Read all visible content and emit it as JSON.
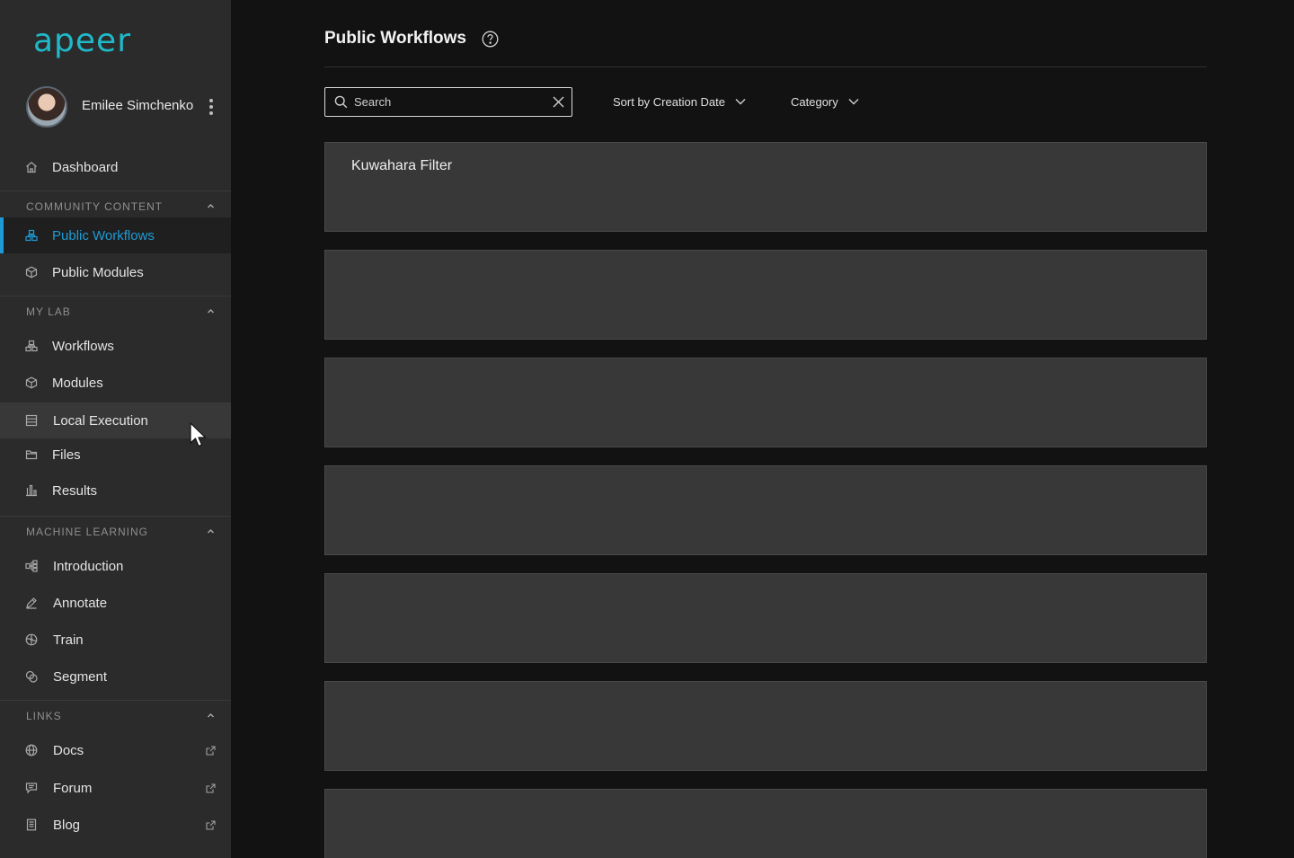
{
  "brand": {
    "logo": "apeer",
    "accent": "#1fb9c9",
    "active_color": "#1e9bd7"
  },
  "user": {
    "name": "Emilee Simchenko"
  },
  "sidebar": {
    "dashboard": "Dashboard",
    "sections": [
      {
        "label": "COMMUNITY CONTENT",
        "items": [
          "Public Workflows",
          "Public Modules"
        ]
      },
      {
        "label": "MY LAB",
        "items": [
          "Workflows",
          "Modules",
          "Local Execution",
          "Files",
          "Results"
        ]
      },
      {
        "label": "MACHINE LEARNING",
        "items": [
          "Introduction",
          "Annotate",
          "Train",
          "Segment"
        ]
      },
      {
        "label": "LINKS",
        "items": [
          "Docs",
          "Forum",
          "Blog"
        ]
      }
    ],
    "active_item": "Public Workflows",
    "hovered_item": "Local Execution"
  },
  "main": {
    "title": "Public Workflows",
    "search": {
      "placeholder": "Search",
      "value": ""
    },
    "sort_label": "Sort by Creation Date",
    "category_label": "Category",
    "cards": [
      {
        "title": "Kuwahara Filter"
      },
      {
        "title": ""
      },
      {
        "title": ""
      },
      {
        "title": ""
      },
      {
        "title": ""
      },
      {
        "title": ""
      },
      {
        "title": ""
      }
    ]
  }
}
